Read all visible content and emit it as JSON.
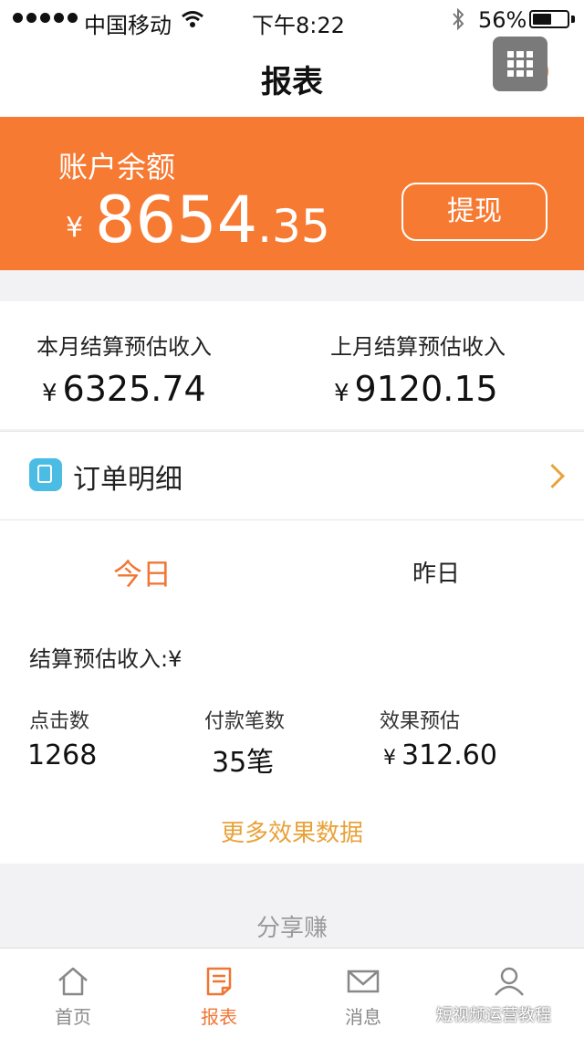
{
  "status_bar": {
    "carrier": "中国移动",
    "time": "下午8:22",
    "battery": "56%",
    "battery_level": 0.56
  },
  "nav": {
    "title": "报表",
    "help_symbol": "?"
  },
  "balance": {
    "label": "账户余额",
    "currency": "¥",
    "amount_int": "8654",
    "amount_dec": ".35",
    "withdraw_label": "提现",
    "color": "#f77a32"
  },
  "income": {
    "this_month_label": "本月结算预估收入",
    "this_month_value": "6325.74",
    "last_month_label": "上月结算预估收入",
    "last_month_value": "9120.15",
    "currency": "¥"
  },
  "orders": {
    "label": "订单明细"
  },
  "stats": {
    "tabs": [
      "今日",
      "昨日"
    ],
    "settle_label": "结算预估收入:¥",
    "items": [
      {
        "label": "点击数",
        "value": "1268"
      },
      {
        "label": "付款笔数",
        "value": "35笔"
      },
      {
        "label": "效果预估",
        "value": "312.60",
        "currency": "¥"
      }
    ],
    "more_label": "更多效果数据"
  },
  "share": {
    "label": "分享赚"
  },
  "tabbar": {
    "items": [
      {
        "label": "首页",
        "icon": "home-icon"
      },
      {
        "label": "报表",
        "icon": "report-icon"
      },
      {
        "label": "消息",
        "icon": "mail-icon"
      },
      {
        "label": "",
        "icon": "user-icon"
      }
    ],
    "active_color": "#f07634"
  },
  "watermark": "短视频运营教程"
}
